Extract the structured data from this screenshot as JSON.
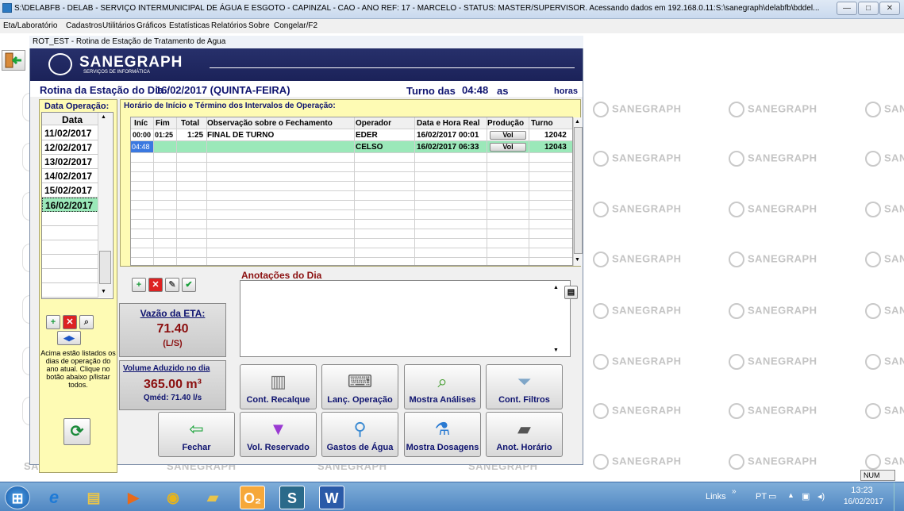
{
  "window": {
    "title": "S:\\DELABFB - DELAB - SERVIÇO INTERMUNICIPAL DE ÁGUA E ESGOTO - CAPINZAL - CAO - ANO REF: 17 - MARCELO -  STATUS: MASTER/SUPERVISOR. Acessando dados em 192.168.0.11:S:\\sanegraph\\delabfb\\bddel..."
  },
  "menu": [
    "Eta/Laboratório",
    "Cadastros",
    "Utilitários",
    "Gráficos",
    "Estatísticas",
    "Relatórios",
    "Sobre",
    "Congelar/F2"
  ],
  "watermark": "SANEGRAPH",
  "inner": {
    "title": "ROT_EST - Rotina de Estação de Tratamento de Agua",
    "logo": "SANEGRAPH",
    "logo_sub": "SERVIÇOS DE INFORMÁTICA",
    "header_label": "Rotina da Estação do Dia :",
    "header_date": "16/02/2017 (QUINTA-FEIRA)",
    "turno_label": "Turno das",
    "turno_time": "04:48",
    "turno_as": "as",
    "horas": "horas"
  },
  "dates_panel": {
    "title": "Data Operação:",
    "col_header": "Data",
    "dates": [
      "11/02/2017",
      "12/02/2017",
      "13/02/2017",
      "14/02/2017",
      "15/02/2017",
      "16/02/2017"
    ],
    "selected_index": 5,
    "info": "Acima estão listados os dias de operação do ano atual. Clique no botão abaixo p/listar todos."
  },
  "intervals": {
    "title": "Horário de Início e Término dos Intervalos de Operação:",
    "columns": [
      "Iníc",
      "Fim",
      "Total",
      "Observação sobre o Fechamento",
      "Operador",
      "Data e Hora Real",
      "Produção",
      "Turno"
    ],
    "rows": [
      {
        "inic": "00:00",
        "fim": "01:25",
        "total": "1:25",
        "obs": "FINAL DE TURNO",
        "operador": "EDER",
        "data_hora": "16/02/2017 00:01",
        "producao": "Vol",
        "turno": "12042"
      },
      {
        "inic": "04:48",
        "fim": "",
        "total": "",
        "obs": "",
        "operador": "CELSO",
        "data_hora": "16/02/2017 06:33",
        "producao": "Vol",
        "turno": "12043"
      }
    ]
  },
  "anotacoes": {
    "title": "Anotações do Dia",
    "text": ""
  },
  "vazao": {
    "title": "Vazão da ETA:",
    "value": "71.40",
    "unit": "(L/S)"
  },
  "volume": {
    "title": "Volume Aduzido no dia",
    "value": "365.00 m³",
    "qmed": "Qméd: 71.40 l/s"
  },
  "buttons": {
    "cont_recalque": "Cont. Recalque",
    "lanc_operacao": "Lanç. Operação",
    "mostra_analises": "Mostra Análises",
    "cont_filtros": "Cont. Filtros",
    "fechar": "Fechar",
    "vol_reservado": "Vol. Reservado",
    "gastos_agua": "Gastos de Água",
    "mostra_dosagens": "Mostra Dosagens",
    "anot_horario": "Anot. Horário"
  },
  "status": {
    "num": "NUM"
  },
  "taskbar": {
    "links": "Links",
    "lang": "PT",
    "time": "13:23",
    "date": "16/02/2017"
  },
  "colors": {
    "navy": "#0f1470",
    "yellow_panel": "#fefbb4",
    "selected_row": "#9be8b9",
    "value_red": "#8b0f0f",
    "logo_bar": "#1b2259"
  }
}
